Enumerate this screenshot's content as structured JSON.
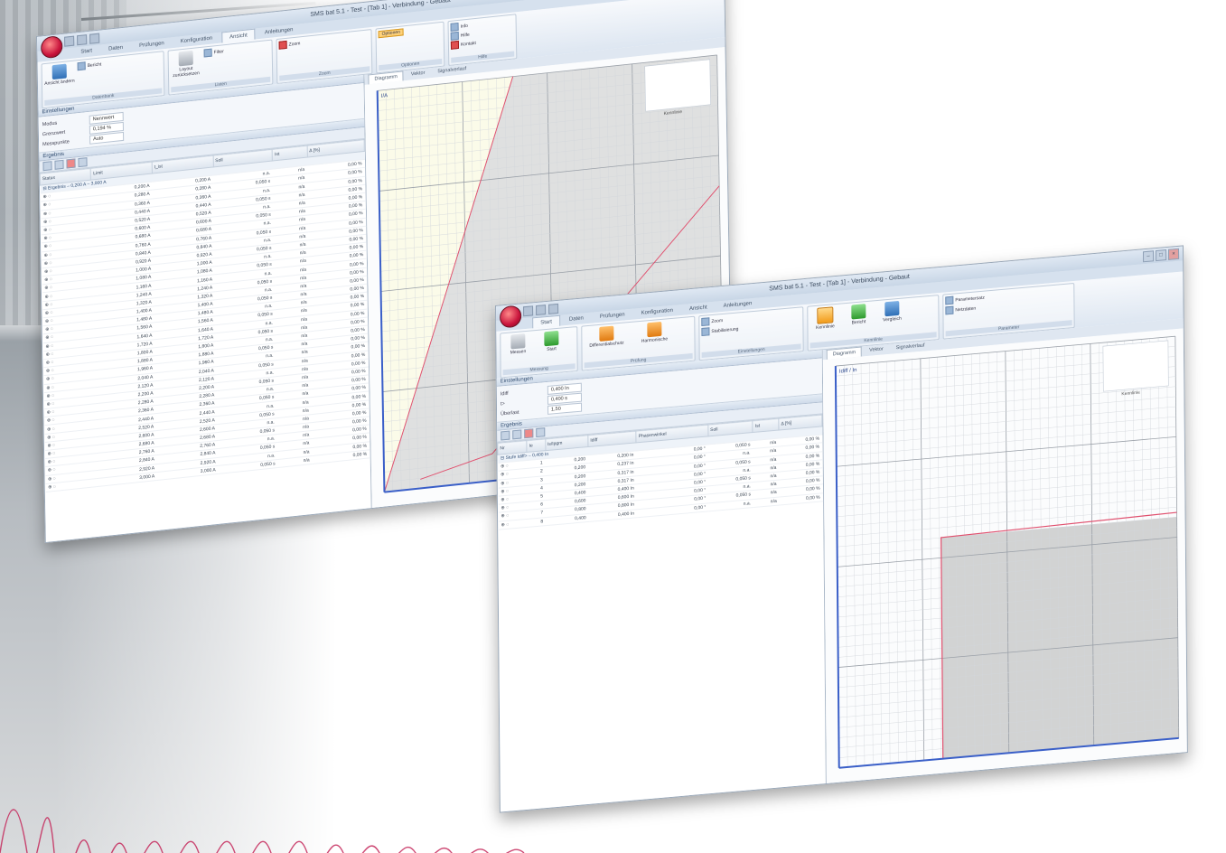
{
  "windows": [
    {
      "id": "win1",
      "title": "SMS bat 5.1 - Test - [Tab 1] - Verbindung - Gebaut",
      "tabs": [
        "Start",
        "Daten",
        "Prüfungen",
        "Konfiguration",
        "Ansicht",
        "Anleitungen"
      ],
      "active_tab": 4,
      "ribbon_groups": [
        {
          "label": "Datenbank",
          "buttons": [
            "Ansicht ändern",
            "Bericht"
          ]
        },
        {
          "label": "Listen",
          "buttons": [
            "Layout zurücksetzen",
            "Filter"
          ]
        },
        {
          "label": "Zoom",
          "buttons": [
            "Zoom"
          ]
        },
        {
          "label": "Optionen",
          "buttons": [
            "Optionen"
          ]
        },
        {
          "label": "Hilfe",
          "buttons": [
            "Info",
            "Hilfe",
            "Kontakt"
          ]
        }
      ],
      "settings": {
        "title": "Einstellungen",
        "rows": [
          {
            "label": "Modus",
            "value": "Nennwert"
          },
          {
            "label": "Grenzwert",
            "value": "0,194 %"
          },
          {
            "label": "Messpunkte",
            "value": "Auto"
          }
        ]
      },
      "results": {
        "title": "Ergebnis",
        "columns": [
          "Status",
          "Limit",
          "t_ist",
          "Soll",
          "Ist",
          "Δ [%]"
        ],
        "group": "Ergebnis – 0,200 A – 3,000 A",
        "rows": [
          [
            "0,200 A",
            "0,200 A",
            "n.a.",
            "n/a",
            "0,00 %"
          ],
          [
            "0,280 A",
            "0,280 A",
            "0,050 s",
            "n/a",
            "0,00 %"
          ],
          [
            "0,360 A",
            "0,360 A",
            "n.a.",
            "n/a",
            "0,00 %"
          ],
          [
            "0,440 A",
            "0,440 A",
            "0,050 s",
            "n/a",
            "0,00 %"
          ],
          [
            "0,520 A",
            "0,520 A",
            "n.a.",
            "n/a",
            "0,00 %"
          ],
          [
            "0,600 A",
            "0,600 A",
            "0,050 s",
            "n/a",
            "0,00 %"
          ],
          [
            "0,680 A",
            "0,680 A",
            "n.a.",
            "n/a",
            "0,00 %"
          ],
          [
            "0,760 A",
            "0,760 A",
            "0,050 s",
            "n/a",
            "0,00 %"
          ],
          [
            "0,840 A",
            "0,840 A",
            "n.a.",
            "n/a",
            "0,00 %"
          ],
          [
            "0,920 A",
            "0,920 A",
            "0,050 s",
            "n/a",
            "0,00 %"
          ],
          [
            "1,000 A",
            "1,000 A",
            "n.a.",
            "n/a",
            "0,00 %"
          ],
          [
            "1,080 A",
            "1,080 A",
            "0,050 s",
            "n/a",
            "0,00 %"
          ],
          [
            "1,160 A",
            "1,160 A",
            "n.a.",
            "n/a",
            "0,00 %"
          ],
          [
            "1,240 A",
            "1,240 A",
            "0,050 s",
            "n/a",
            "0,00 %"
          ],
          [
            "1,320 A",
            "1,320 A",
            "n.a.",
            "n/a",
            "0,00 %"
          ],
          [
            "1,400 A",
            "1,400 A",
            "0,050 s",
            "n/a",
            "0,00 %"
          ],
          [
            "1,480 A",
            "1,480 A",
            "n.a.",
            "n/a",
            "0,00 %"
          ],
          [
            "1,560 A",
            "1,560 A",
            "0,050 s",
            "n/a",
            "0,00 %"
          ],
          [
            "1,640 A",
            "1,640 A",
            "n.a.",
            "n/a",
            "0,00 %"
          ],
          [
            "1,720 A",
            "1,720 A",
            "0,050 s",
            "n/a",
            "0,00 %"
          ],
          [
            "1,800 A",
            "1,800 A",
            "n.a.",
            "n/a",
            "0,00 %"
          ],
          [
            "1,880 A",
            "1,880 A",
            "0,050 s",
            "n/a",
            "0,00 %"
          ],
          [
            "1,960 A",
            "1,960 A",
            "n.a.",
            "n/a",
            "0,00 %"
          ],
          [
            "2,040 A",
            "2,040 A",
            "0,050 s",
            "n/a",
            "0,00 %"
          ],
          [
            "2,120 A",
            "2,120 A",
            "n.a.",
            "n/a",
            "0,00 %"
          ],
          [
            "2,200 A",
            "2,200 A",
            "0,050 s",
            "n/a",
            "0,00 %"
          ],
          [
            "2,280 A",
            "2,280 A",
            "n.a.",
            "n/a",
            "0,00 %"
          ],
          [
            "2,360 A",
            "2,360 A",
            "0,050 s",
            "n/a",
            "0,00 %"
          ],
          [
            "2,440 A",
            "2,440 A",
            "n.a.",
            "n/a",
            "0,00 %"
          ],
          [
            "2,520 A",
            "2,520 A",
            "0,050 s",
            "n/a",
            "0,00 %"
          ],
          [
            "2,600 A",
            "2,600 A",
            "n.a.",
            "n/a",
            "0,00 %"
          ],
          [
            "2,680 A",
            "2,680 A",
            "0,050 s",
            "n/a",
            "0,00 %"
          ],
          [
            "2,760 A",
            "2,760 A",
            "n.a.",
            "n/a",
            "0,00 %"
          ],
          [
            "2,840 A",
            "2,840 A",
            "0,050 s",
            "n/a",
            "0,00 %"
          ],
          [
            "2,920 A",
            "2,920 A",
            "n.a.",
            "n/a",
            "0,00 %"
          ],
          [
            "3,000 A",
            "3,000 A",
            "0,050 s",
            "n/a",
            "0,00 %"
          ]
        ]
      },
      "chart_tabs": [
        "Diagramm",
        "Vektor",
        "Signalverlauf"
      ],
      "chart_label": "I/A",
      "chart_caption": "Kennlinie"
    },
    {
      "id": "win2",
      "title": "SMS bat 5.1 - Test - [Tab 1] - Verbindung - Gebaut",
      "tabs": [
        "Start",
        "Daten",
        "Prüfungen",
        "Konfiguration",
        "Ansicht",
        "Anleitungen"
      ],
      "active_tab": 0,
      "ribbon_groups": [
        {
          "label": "Messung",
          "buttons": [
            "Messen",
            "Start"
          ]
        },
        {
          "label": "Prüfung",
          "buttons": [
            "Differentialschutz",
            "Harmonische"
          ]
        },
        {
          "label": "Einstellungen",
          "buttons": [
            "Zoom",
            "Stabilisierung"
          ]
        },
        {
          "label": "Kennlinie",
          "buttons": [
            "Kennlinie",
            "Bericht",
            "Vergleich"
          ]
        },
        {
          "label": "Parameter",
          "buttons": [
            "Parametersatz",
            "Netzdaten"
          ]
        }
      ],
      "settings": {
        "title": "Einstellungen",
        "rows": [
          {
            "label": "Idiff",
            "value": "0,400 In"
          },
          {
            "label": "t>",
            "value": "0,400 s"
          },
          {
            "label": "Überlast",
            "value": "1,50"
          }
        ]
      },
      "results": {
        "title": "Ergebnis",
        "columns": [
          "Nr",
          "Ie",
          "Is/Ipgm",
          "Idiff",
          "Phasenwinkel",
          "Soll",
          "Ist",
          "Δ [%]"
        ],
        "group": "Stufe Idiff> – 0,400 In",
        "rows": [
          [
            "1",
            "0,200",
            "0,200 In",
            "0,00 °",
            "0,050 s",
            "n/a",
            "0,00 %"
          ],
          [
            "2",
            "0,200",
            "0,237 In",
            "0,00 °",
            "n.a.",
            "n/a",
            "0,00 %"
          ],
          [
            "3",
            "0,200",
            "0,317 In",
            "0,00 °",
            "0,050 s",
            "n/a",
            "0,00 %"
          ],
          [
            "4",
            "0,200",
            "0,317 In",
            "0,00 °",
            "n.a.",
            "n/a",
            "0,00 %"
          ],
          [
            "5",
            "0,400",
            "0,400 In",
            "0,00 °",
            "0,050 s",
            "n/a",
            "0,00 %"
          ],
          [
            "6",
            "0,600",
            "0,600 In",
            "0,00 °",
            "n.a.",
            "n/a",
            "0,00 %"
          ],
          [
            "7",
            "0,800",
            "0,800 In",
            "0,00 °",
            "0,050 s",
            "n/a",
            "0,00 %"
          ],
          [
            "8",
            "0,400",
            "0,400 In",
            "0,00 °",
            "n.a.",
            "n/a",
            "0,00 %"
          ]
        ]
      },
      "chart_tabs": [
        "Diagramm",
        "Vektor",
        "Signalverlauf"
      ],
      "chart_label": "Idiff / In",
      "chart_caption": "Kennlinie"
    }
  ],
  "colors": {
    "ribbon_highlight": "#f29b19",
    "curve": "#e0506e",
    "fill": "#c8c8c8",
    "axis": "#3a5fc8"
  }
}
